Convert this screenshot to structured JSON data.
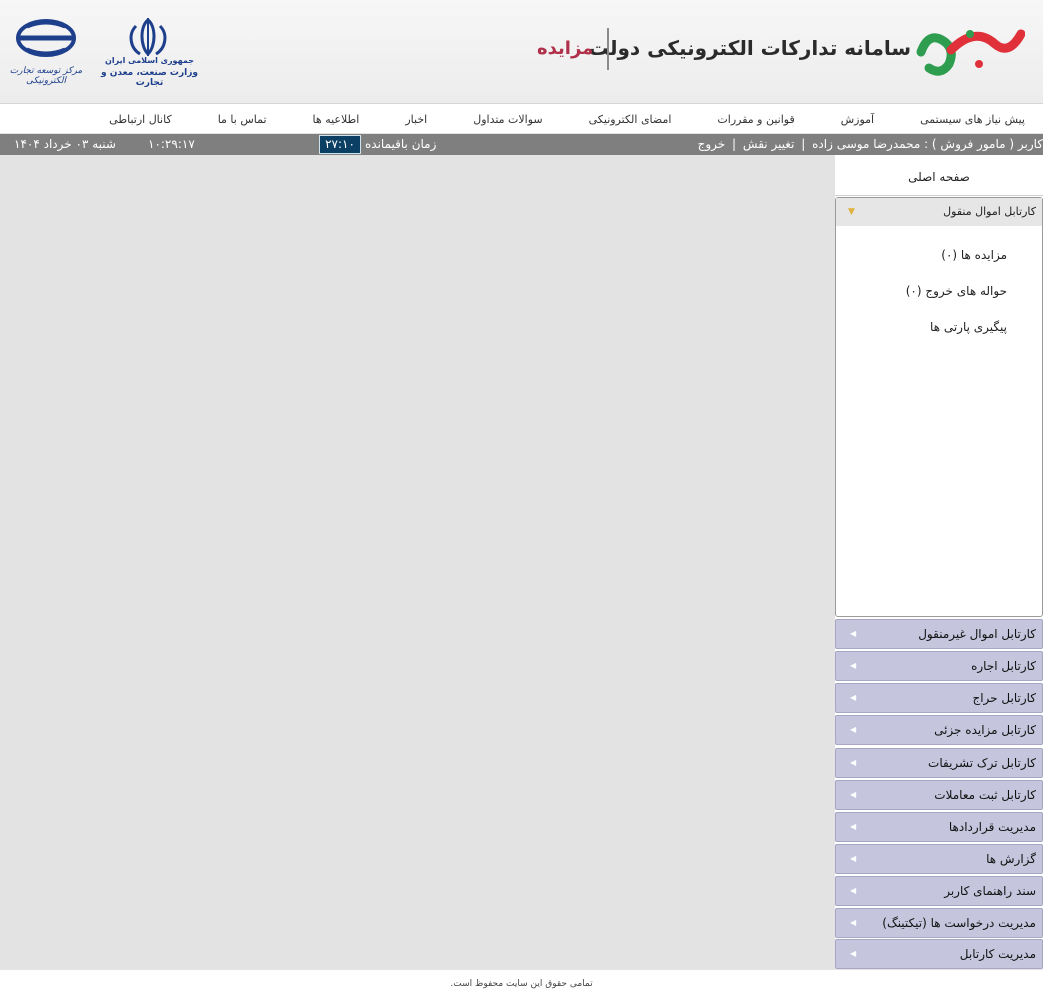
{
  "header": {
    "site_title": "سامانه تدارکات الکترونیکی دولت",
    "site_subtitle": "مزایده",
    "gov_line1": "جمهوری اسلامی ایران",
    "gov_line2": "وزارت صنعت، معدن و تجارت",
    "center_caption": "مرکز توسعه تجارت الکترونیکی"
  },
  "topnav": {
    "items": [
      "پیش نیاز های سیستمی",
      "آموزش",
      "قوانین و مقررات",
      "امضای الکترونیکی",
      "سوالات متداول",
      "اخبار",
      "اطلاعیه ها",
      "تماس با ما",
      "کانال ارتباطی"
    ]
  },
  "status": {
    "user_text": "کاربر ( مامور فروش ) : محمدرضا موسی زاده",
    "change_role": "تغییر نقش",
    "logout": "خروج",
    "separator": "|",
    "remaining_label": "زمان باقیمانده",
    "remaining_value": "۲۷:۱۰",
    "clock": "۱۰:۲۹:۱۷",
    "date": "شنبه ۰۳ خرداد ۱۴۰۴"
  },
  "sidebar": {
    "home": "صفحه اصلی",
    "open_section": {
      "title": "کارتابل اموال منقول",
      "items": [
        "مزایده ها (۰)",
        "حواله های خروج (۰)",
        "پیگیری پارتی ها"
      ]
    },
    "sections": [
      "کارتابل اموال غیرمنقول",
      "کارتابل اجاره",
      "کارتابل حراج",
      "کارتابل مزایده جزئی",
      "کارتابل ترک تشریفات",
      "کارتابل ثبت معاملات",
      "مدیریت قراردادها",
      "گزارش ها",
      "سند راهنمای کاربر",
      "مدیریت درخواست ها (تیکتینگ)",
      "مدیریت کارتابل"
    ]
  },
  "footer": {
    "text": "تمامی حقوق این سایت محفوظ است."
  },
  "colors": {
    "brand_red": "#e0313a",
    "brand_green": "#2e9d4f",
    "subtitle": "#b0304a",
    "status_bar": "#7f7f7f",
    "timer_bg": "#0b3f63",
    "accordion": "#c5c5dd"
  }
}
